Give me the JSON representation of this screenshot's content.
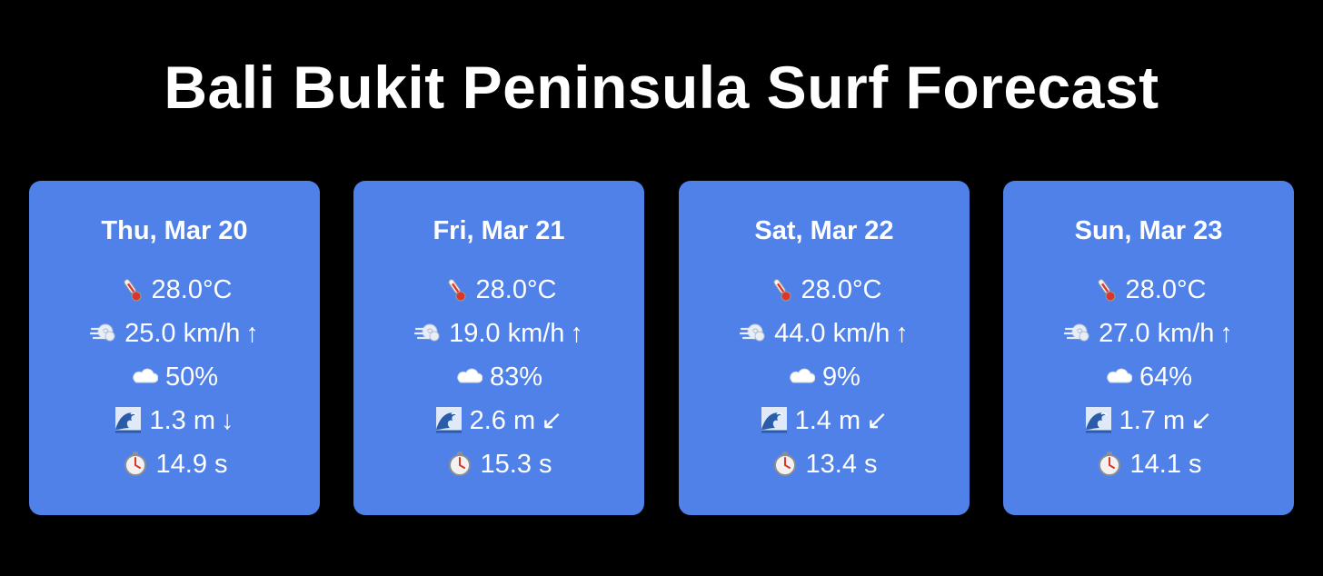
{
  "title": "Bali Bukit Peninsula Surf Forecast",
  "colors": {
    "background": "#000000",
    "card": "#4f81e9",
    "text": "#ffffff"
  },
  "days": [
    {
      "date": "Thu, Mar 20",
      "temperature": "28.0°C",
      "wind": "25.0 km/h",
      "wind_arrow": "↑",
      "cloud": "50%",
      "wave": "1.3 m",
      "wave_arrow": "↓",
      "period": "14.9 s"
    },
    {
      "date": "Fri, Mar 21",
      "temperature": "28.0°C",
      "wind": "19.0 km/h",
      "wind_arrow": "↑",
      "cloud": "83%",
      "wave": "2.6 m",
      "wave_arrow": "↙",
      "period": "15.3 s"
    },
    {
      "date": "Sat, Mar 22",
      "temperature": "28.0°C",
      "wind": "44.0 km/h",
      "wind_arrow": "↑",
      "cloud": "9%",
      "wave": "1.4 m",
      "wave_arrow": "↙",
      "period": "13.4 s"
    },
    {
      "date": "Sun, Mar 23",
      "temperature": "28.0°C",
      "wind": "27.0 km/h",
      "wind_arrow": "↑",
      "cloud": "64%",
      "wave": "1.7 m",
      "wave_arrow": "↙",
      "period": "14.1 s"
    }
  ],
  "icons": {
    "temperature": "thermometer-icon",
    "wind": "wind-icon",
    "cloud": "cloud-icon",
    "wave": "wave-icon",
    "period": "stopwatch-icon"
  }
}
